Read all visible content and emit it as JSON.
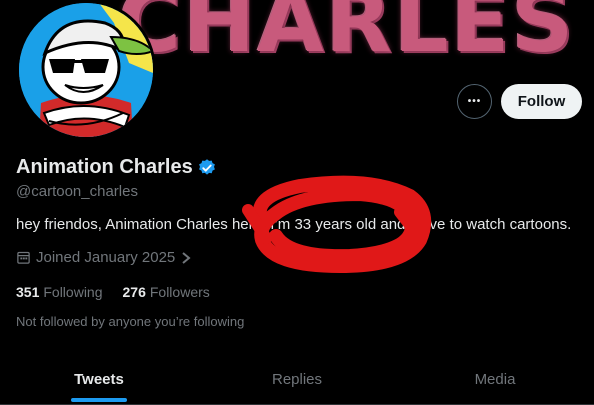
{
  "banner": {
    "text": "CHARLES"
  },
  "profile": {
    "display_name": "Animation Charles",
    "verified_icon": "verified-badge-icon",
    "handle": "@cartoon_charles",
    "bio": "hey friendos, Animation Charles here. I’m 33 years old and I love to watch cartoons.",
    "joined": "Joined January 2025",
    "following_count": "351",
    "following_label": "Following",
    "followers_count": "276",
    "followers_label": "Followers",
    "not_followed_text": "Not followed by anyone you’re following"
  },
  "actions": {
    "more_label": "•••",
    "follow_label": "Follow"
  },
  "tabs": [
    {
      "label": "Tweets",
      "active": true
    },
    {
      "label": "Replies",
      "active": false
    },
    {
      "label": "Media",
      "active": false
    }
  ],
  "colors": {
    "accent": "#1d9bf0",
    "scribble": "#e01818",
    "banner_text": "#c85a7c"
  }
}
